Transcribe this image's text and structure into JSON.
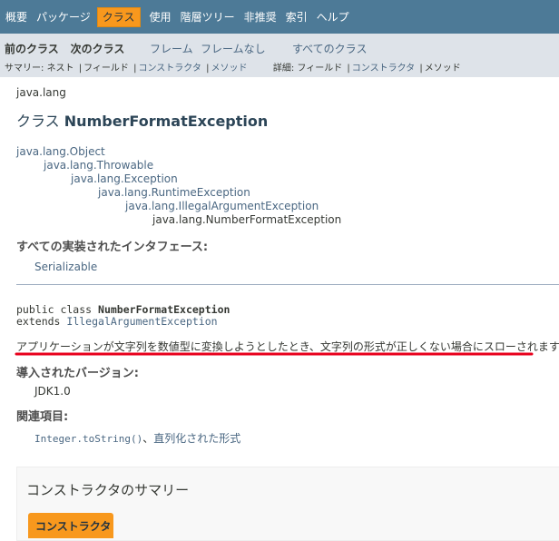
{
  "topnav": {
    "items": [
      "概要",
      "パッケージ",
      "クラス",
      "使用",
      "階層ツリー",
      "非推奨",
      "索引",
      "ヘルプ"
    ],
    "active_index": 2
  },
  "subnav": {
    "prev_class": "前のクラス",
    "next_class": "次のクラス",
    "frames": "フレーム",
    "no_frames": "フレームなし",
    "all_classes": "すべてのクラス",
    "summary_label": "サマリー:",
    "summary_nested": "ネスト",
    "summary_field": "フィールド",
    "summary_constructor": "コンストラクタ",
    "summary_method": "メソッド",
    "detail_label": "詳細:",
    "detail_field": "フィールド",
    "detail_constructor": "コンストラクタ",
    "detail_method": "メソッド",
    "sep": "|"
  },
  "header": {
    "package": "java.lang",
    "title_prefix": "クラス",
    "class_name": "NumberFormatException"
  },
  "inheritance": [
    "java.lang.Object",
    "java.lang.Throwable",
    "java.lang.Exception",
    "java.lang.RuntimeException",
    "java.lang.IllegalArgumentException",
    "java.lang.NumberFormatException"
  ],
  "interfaces": {
    "heading": "すべての実装されたインタフェース:",
    "value": "Serializable"
  },
  "declaration": {
    "prefix": "public class",
    "name": "NumberFormatException",
    "extends_kw": "extends",
    "parent": "IllegalArgumentException"
  },
  "description": "アプリケーションが文字列を数値型に変換しようとしたとき、文字列の形式が正しくない場合にスローされます。",
  "annotation_color": "#e8001c",
  "since": {
    "heading": "導入されたバージョン:",
    "value": "JDK1.0"
  },
  "see_also": {
    "heading": "関連項目:",
    "link1": "Integer.toString()",
    "sep": "、",
    "link2": "直列化された形式"
  },
  "summary": {
    "title": "コンストラクタのサマリー",
    "tab": "コンストラクタ"
  }
}
